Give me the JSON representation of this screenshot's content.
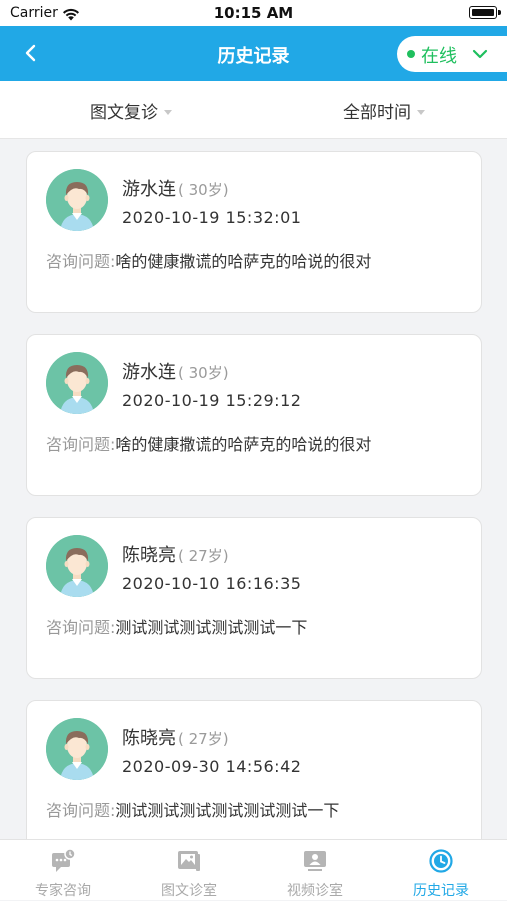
{
  "status_bar": {
    "carrier": "Carrier",
    "time": "10:15 AM"
  },
  "header": {
    "title": "历史记录",
    "status_label": "在线",
    "status_color": "#1fbf5e",
    "accent_color": "#21a8e6",
    "back_icon": "chevron-left-icon"
  },
  "filters": [
    {
      "label": "图文复诊"
    },
    {
      "label": "全部时间"
    }
  ],
  "records": [
    {
      "name": "游水连",
      "age": "( 30岁)",
      "datetime": "2020-10-19 15:32:01",
      "question_label": "咨询问题:",
      "question": "啥的健康撒谎的哈萨克的哈说的很对"
    },
    {
      "name": "游水连",
      "age": "( 30岁)",
      "datetime": "2020-10-19 15:29:12",
      "question_label": "咨询问题:",
      "question": "啥的健康撒谎的哈萨克的哈说的很对"
    },
    {
      "name": "陈晓亮",
      "age": "( 27岁)",
      "datetime": "2020-10-10 16:16:35",
      "question_label": "咨询问题:",
      "question": "测试测试测试测试测试一下"
    },
    {
      "name": "陈晓亮",
      "age": "( 27岁)",
      "datetime": "2020-09-30 14:56:42",
      "question_label": "咨询问题:",
      "question": "测试测试测试测试测试测试一下"
    }
  ],
  "tabs": [
    {
      "label": "专家咨询",
      "icon": "expert-consult-icon",
      "active": false
    },
    {
      "label": "图文诊室",
      "icon": "image-text-clinic-icon",
      "active": false
    },
    {
      "label": "视频诊室",
      "icon": "video-clinic-icon",
      "active": false
    },
    {
      "label": "历史记录",
      "icon": "history-clock-icon",
      "active": true
    }
  ]
}
